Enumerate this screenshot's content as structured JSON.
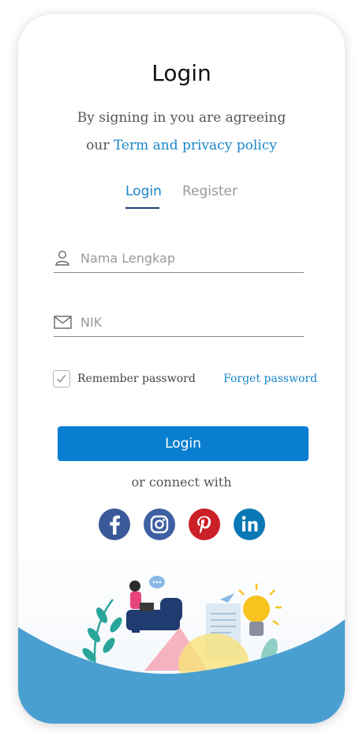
{
  "header": {
    "title": "Login",
    "subtitle_line1": "By signing in you are agreeing",
    "subtitle_prefix": "our",
    "terms_link": "Term and privacy policy"
  },
  "tabs": {
    "login": "Login",
    "register": "Register"
  },
  "form": {
    "name_placeholder": "Nama Lengkap",
    "nik_placeholder": "NIK",
    "remember_label": "Remember password",
    "remember_checked": true,
    "forget_label": "Forget password",
    "submit_label": "Login"
  },
  "connect": {
    "label": "or connect with",
    "icons": [
      "facebook-icon",
      "instagram-icon",
      "pinterest-icon",
      "linkedin-icon"
    ]
  },
  "colors": {
    "accent": "#0a7fd1",
    "link": "#1a86c9",
    "wave": "#4a9fd1",
    "facebook": "#3b5998",
    "instagram": "#3f5fa3",
    "pinterest": "#cb2027",
    "linkedin": "#0a78b5"
  }
}
